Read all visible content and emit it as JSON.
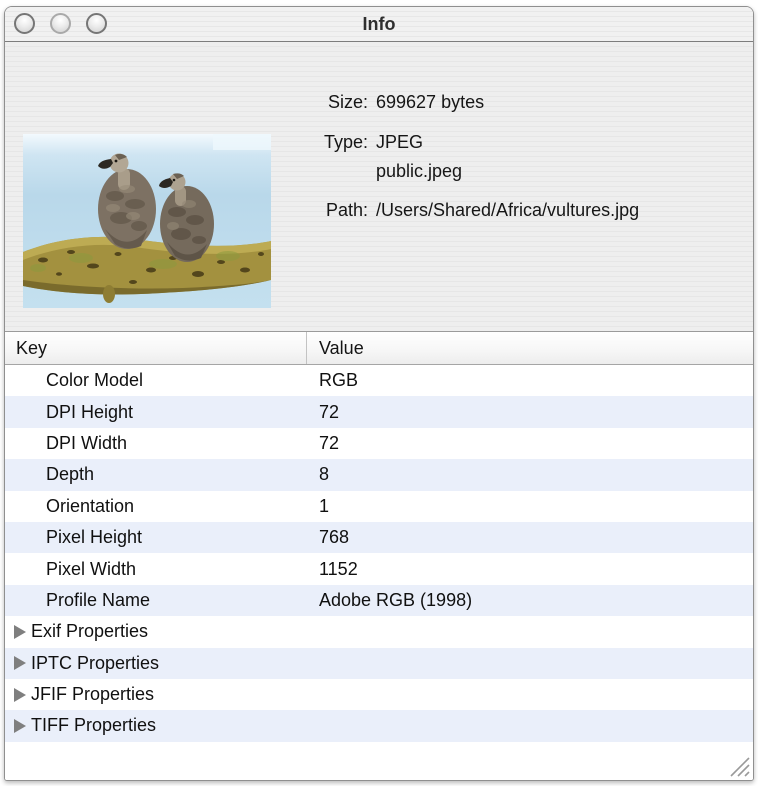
{
  "window": {
    "title": "Info",
    "controls": [
      {
        "name": "close-button"
      },
      {
        "name": "minimize-button"
      },
      {
        "name": "zoom-button"
      }
    ]
  },
  "preview": {
    "description": "two vultures perched on a branch against a blue sky",
    "icon": "vultures-thumbnail"
  },
  "metadata": {
    "size_label": "Size:",
    "size_value": "699627 bytes",
    "type_label": "Type:",
    "type_value": "JPEG",
    "type_uti": "public.jpeg",
    "path_label": "Path:",
    "path_value": "/Users/Shared/Africa/vultures.jpg"
  },
  "table": {
    "columns": [
      "Key",
      "Value"
    ],
    "rows": [
      {
        "key": "Color Model",
        "value": "RGB"
      },
      {
        "key": "DPI Height",
        "value": "72"
      },
      {
        "key": "DPI Width",
        "value": "72"
      },
      {
        "key": "Depth",
        "value": "8"
      },
      {
        "key": "Orientation",
        "value": "1"
      },
      {
        "key": "Pixel Height",
        "value": "768"
      },
      {
        "key": "Pixel Width",
        "value": "1152"
      },
      {
        "key": "Profile Name",
        "value": "Adobe RGB (1998)"
      }
    ],
    "groups": [
      {
        "key": "Exif Properties",
        "state": "collapsed",
        "icon": "disclosure-triangle-right"
      },
      {
        "key": "IPTC Properties",
        "state": "collapsed",
        "icon": "disclosure-triangle-right"
      },
      {
        "key": "JFIF Properties",
        "state": "collapsed",
        "icon": "disclosure-triangle-right"
      },
      {
        "key": "TIFF Properties",
        "state": "collapsed",
        "icon": "disclosure-triangle-right"
      }
    ]
  },
  "colors": {
    "alt_row_blue": "#eaeffa",
    "pinstripe_gray": "#ebebeb",
    "sky_blue": "#b9d8ea",
    "branch_olive": "#a3913f",
    "bird_brown": "#7d7163"
  },
  "icons": {
    "resize_grip": "diagonal-lines",
    "traffic_light": "hollow-gray-circle"
  }
}
